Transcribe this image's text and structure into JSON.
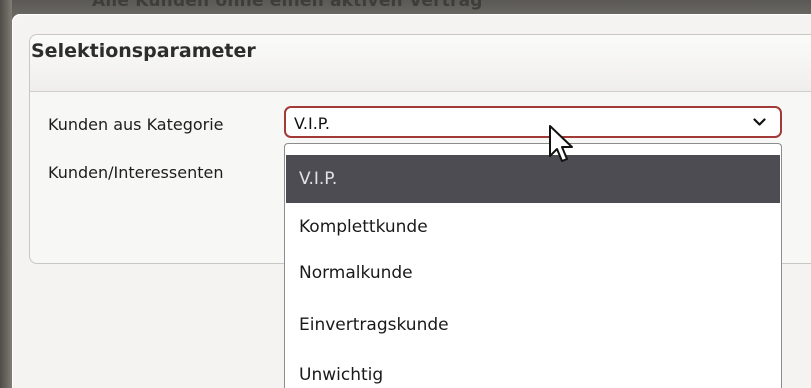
{
  "window": {
    "title": "Alle Kunden ohne einen aktiven Vertrag"
  },
  "group": {
    "title": "Selektionsparameter"
  },
  "fields": {
    "category_label": "Kunden aus Kategorie",
    "kunden_label": "Kunden/Interessenten"
  },
  "select": {
    "value": "V.I.P.",
    "options": [
      "V.I.P.",
      "Komplettkunde",
      "Normalkunde",
      "Einvertragskunde",
      "Unwichtig"
    ],
    "selected_index": 0
  },
  "colors": {
    "select_border": "#a23a38",
    "selected_option_bg": "#4c4c52"
  },
  "icons": {
    "dropdown": "chevron-down-icon",
    "pointer": "mouse-pointer-icon"
  }
}
